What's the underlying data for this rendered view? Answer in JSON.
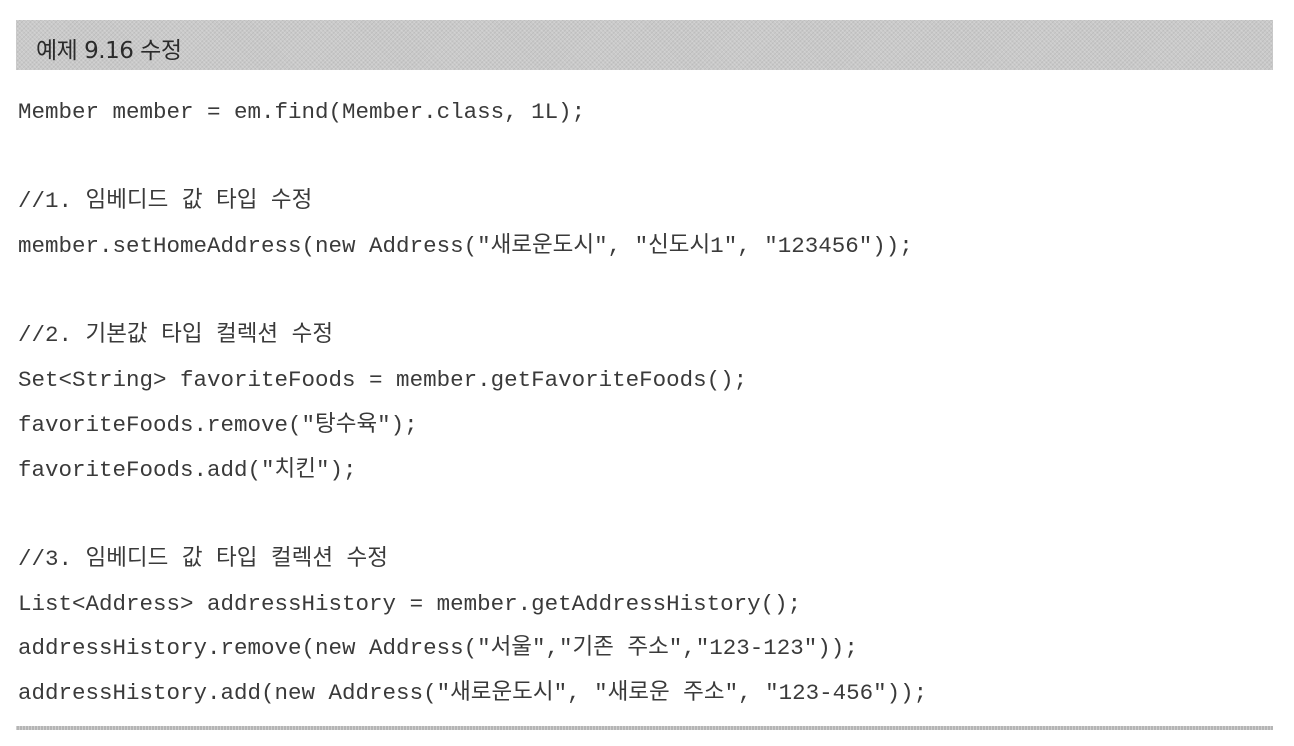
{
  "header": {
    "title": "예제 9.16 수정"
  },
  "code_lines": [
    "Member member = em.find(Member.class, 1L);",
    "",
    "//1. 임베디드 값 타입 수정",
    "member.setHomeAddress(new Address(\"새로운도시\", \"신도시1\", \"123456\"));",
    "",
    "//2. 기본값 타입 컬렉션 수정",
    "Set<String> favoriteFoods = member.getFavoriteFoods();",
    "favoriteFoods.remove(\"탕수육\");",
    "favoriteFoods.add(\"치킨\");",
    "",
    "//3. 임베디드 값 타입 컬렉션 수정",
    "List<Address> addressHistory = member.getAddressHistory();",
    "addressHistory.remove(new Address(\"서울\",\"기존 주소\",\"123-123\"));",
    "addressHistory.add(new Address(\"새로운도시\", \"새로운 주소\", \"123-456\"));"
  ]
}
